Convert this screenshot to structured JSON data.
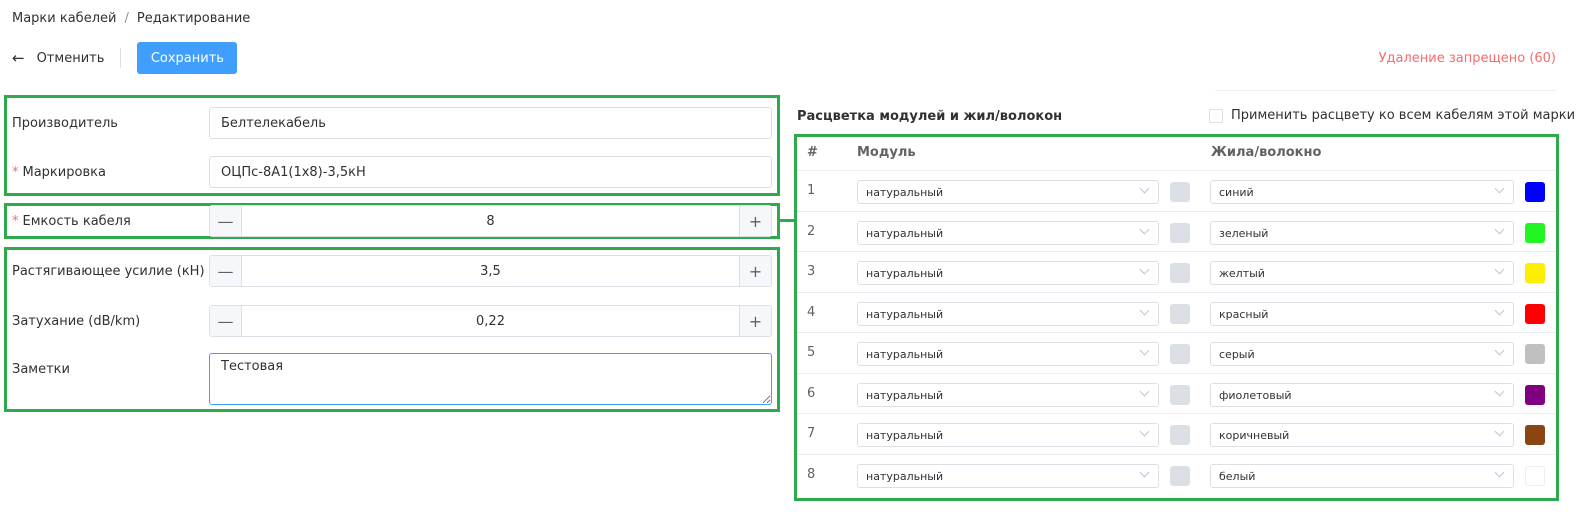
{
  "breadcrumb": {
    "root": "Марки кабелей",
    "separator": "/",
    "current": "Редактирование"
  },
  "toolbar": {
    "cancel_icon": "←",
    "cancel_label": "Отменить",
    "save_label": "Сохранить"
  },
  "delete_status": "Удаление запрещено (60)",
  "form": {
    "manufacturer": {
      "label": "Производитель",
      "value": "Белтелекабель"
    },
    "marking": {
      "required_mark": "*",
      "label": "Маркировка",
      "value": "ОЦПс-8А1(1х8)-3,5кН"
    },
    "capacity": {
      "required_mark": "*",
      "label": "Емкость кабеля",
      "value": "8"
    },
    "tension": {
      "label": "Растягивающее усилие (кН)",
      "value": "3,5"
    },
    "attenuation": {
      "label": "Затухание (dB/km)",
      "value": "0,22"
    },
    "notes": {
      "label": "Заметки",
      "value": "Тестовая"
    },
    "stepper_minus": "—",
    "stepper_plus": "+"
  },
  "colors_section": {
    "title": "Расцветка модулей и жил/волокон",
    "apply_all_label": "Применить расцвету ко всем кабелям этой марки",
    "headers": {
      "num": "#",
      "module": "Модуль",
      "fiber": "Жила/волокно"
    },
    "rows": [
      {
        "num": "1",
        "module": "натуральный",
        "module_color": "#dcdfe6",
        "fiber": "синий",
        "fiber_color": "#0000ff"
      },
      {
        "num": "2",
        "module": "натуральный",
        "module_color": "#dcdfe6",
        "fiber": "зеленый",
        "fiber_color": "#22f522"
      },
      {
        "num": "3",
        "module": "натуральный",
        "module_color": "#dcdfe6",
        "fiber": "желтый",
        "fiber_color": "#ffee00"
      },
      {
        "num": "4",
        "module": "натуральный",
        "module_color": "#dcdfe6",
        "fiber": "красный",
        "fiber_color": "#ff0000"
      },
      {
        "num": "5",
        "module": "натуральный",
        "module_color": "#dcdfe6",
        "fiber": "серый",
        "fiber_color": "#c0c0c0"
      },
      {
        "num": "6",
        "module": "натуральный",
        "module_color": "#dcdfe6",
        "fiber": "фиолетовый",
        "fiber_color": "#800080"
      },
      {
        "num": "7",
        "module": "натуральный",
        "module_color": "#dcdfe6",
        "fiber": "коричневый",
        "fiber_color": "#8b4513"
      },
      {
        "num": "8",
        "module": "натуральный",
        "module_color": "#dcdfe6",
        "fiber": "белый",
        "fiber_color": "#ffffff"
      }
    ]
  },
  "theme": {
    "primary": "#409eff",
    "danger": "#f56c6c",
    "highlight_frame": "#2ea94b"
  }
}
